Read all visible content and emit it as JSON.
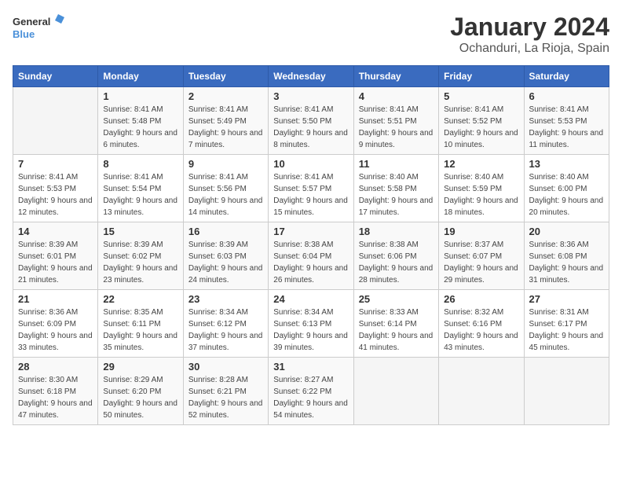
{
  "header": {
    "logo_line1": "General",
    "logo_line2": "Blue",
    "month": "January 2024",
    "location": "Ochanduri, La Rioja, Spain"
  },
  "weekdays": [
    "Sunday",
    "Monday",
    "Tuesday",
    "Wednesday",
    "Thursday",
    "Friday",
    "Saturday"
  ],
  "weeks": [
    [
      {
        "num": "",
        "sunrise": "",
        "sunset": "",
        "daylight": ""
      },
      {
        "num": "1",
        "sunrise": "Sunrise: 8:41 AM",
        "sunset": "Sunset: 5:48 PM",
        "daylight": "Daylight: 9 hours and 6 minutes."
      },
      {
        "num": "2",
        "sunrise": "Sunrise: 8:41 AM",
        "sunset": "Sunset: 5:49 PM",
        "daylight": "Daylight: 9 hours and 7 minutes."
      },
      {
        "num": "3",
        "sunrise": "Sunrise: 8:41 AM",
        "sunset": "Sunset: 5:50 PM",
        "daylight": "Daylight: 9 hours and 8 minutes."
      },
      {
        "num": "4",
        "sunrise": "Sunrise: 8:41 AM",
        "sunset": "Sunset: 5:51 PM",
        "daylight": "Daylight: 9 hours and 9 minutes."
      },
      {
        "num": "5",
        "sunrise": "Sunrise: 8:41 AM",
        "sunset": "Sunset: 5:52 PM",
        "daylight": "Daylight: 9 hours and 10 minutes."
      },
      {
        "num": "6",
        "sunrise": "Sunrise: 8:41 AM",
        "sunset": "Sunset: 5:53 PM",
        "daylight": "Daylight: 9 hours and 11 minutes."
      }
    ],
    [
      {
        "num": "7",
        "sunrise": "Sunrise: 8:41 AM",
        "sunset": "Sunset: 5:53 PM",
        "daylight": "Daylight: 9 hours and 12 minutes."
      },
      {
        "num": "8",
        "sunrise": "Sunrise: 8:41 AM",
        "sunset": "Sunset: 5:54 PM",
        "daylight": "Daylight: 9 hours and 13 minutes."
      },
      {
        "num": "9",
        "sunrise": "Sunrise: 8:41 AM",
        "sunset": "Sunset: 5:56 PM",
        "daylight": "Daylight: 9 hours and 14 minutes."
      },
      {
        "num": "10",
        "sunrise": "Sunrise: 8:41 AM",
        "sunset": "Sunset: 5:57 PM",
        "daylight": "Daylight: 9 hours and 15 minutes."
      },
      {
        "num": "11",
        "sunrise": "Sunrise: 8:40 AM",
        "sunset": "Sunset: 5:58 PM",
        "daylight": "Daylight: 9 hours and 17 minutes."
      },
      {
        "num": "12",
        "sunrise": "Sunrise: 8:40 AM",
        "sunset": "Sunset: 5:59 PM",
        "daylight": "Daylight: 9 hours and 18 minutes."
      },
      {
        "num": "13",
        "sunrise": "Sunrise: 8:40 AM",
        "sunset": "Sunset: 6:00 PM",
        "daylight": "Daylight: 9 hours and 20 minutes."
      }
    ],
    [
      {
        "num": "14",
        "sunrise": "Sunrise: 8:39 AM",
        "sunset": "Sunset: 6:01 PM",
        "daylight": "Daylight: 9 hours and 21 minutes."
      },
      {
        "num": "15",
        "sunrise": "Sunrise: 8:39 AM",
        "sunset": "Sunset: 6:02 PM",
        "daylight": "Daylight: 9 hours and 23 minutes."
      },
      {
        "num": "16",
        "sunrise": "Sunrise: 8:39 AM",
        "sunset": "Sunset: 6:03 PM",
        "daylight": "Daylight: 9 hours and 24 minutes."
      },
      {
        "num": "17",
        "sunrise": "Sunrise: 8:38 AM",
        "sunset": "Sunset: 6:04 PM",
        "daylight": "Daylight: 9 hours and 26 minutes."
      },
      {
        "num": "18",
        "sunrise": "Sunrise: 8:38 AM",
        "sunset": "Sunset: 6:06 PM",
        "daylight": "Daylight: 9 hours and 28 minutes."
      },
      {
        "num": "19",
        "sunrise": "Sunrise: 8:37 AM",
        "sunset": "Sunset: 6:07 PM",
        "daylight": "Daylight: 9 hours and 29 minutes."
      },
      {
        "num": "20",
        "sunrise": "Sunrise: 8:36 AM",
        "sunset": "Sunset: 6:08 PM",
        "daylight": "Daylight: 9 hours and 31 minutes."
      }
    ],
    [
      {
        "num": "21",
        "sunrise": "Sunrise: 8:36 AM",
        "sunset": "Sunset: 6:09 PM",
        "daylight": "Daylight: 9 hours and 33 minutes."
      },
      {
        "num": "22",
        "sunrise": "Sunrise: 8:35 AM",
        "sunset": "Sunset: 6:11 PM",
        "daylight": "Daylight: 9 hours and 35 minutes."
      },
      {
        "num": "23",
        "sunrise": "Sunrise: 8:34 AM",
        "sunset": "Sunset: 6:12 PM",
        "daylight": "Daylight: 9 hours and 37 minutes."
      },
      {
        "num": "24",
        "sunrise": "Sunrise: 8:34 AM",
        "sunset": "Sunset: 6:13 PM",
        "daylight": "Daylight: 9 hours and 39 minutes."
      },
      {
        "num": "25",
        "sunrise": "Sunrise: 8:33 AM",
        "sunset": "Sunset: 6:14 PM",
        "daylight": "Daylight: 9 hours and 41 minutes."
      },
      {
        "num": "26",
        "sunrise": "Sunrise: 8:32 AM",
        "sunset": "Sunset: 6:16 PM",
        "daylight": "Daylight: 9 hours and 43 minutes."
      },
      {
        "num": "27",
        "sunrise": "Sunrise: 8:31 AM",
        "sunset": "Sunset: 6:17 PM",
        "daylight": "Daylight: 9 hours and 45 minutes."
      }
    ],
    [
      {
        "num": "28",
        "sunrise": "Sunrise: 8:30 AM",
        "sunset": "Sunset: 6:18 PM",
        "daylight": "Daylight: 9 hours and 47 minutes."
      },
      {
        "num": "29",
        "sunrise": "Sunrise: 8:29 AM",
        "sunset": "Sunset: 6:20 PM",
        "daylight": "Daylight: 9 hours and 50 minutes."
      },
      {
        "num": "30",
        "sunrise": "Sunrise: 8:28 AM",
        "sunset": "Sunset: 6:21 PM",
        "daylight": "Daylight: 9 hours and 52 minutes."
      },
      {
        "num": "31",
        "sunrise": "Sunrise: 8:27 AM",
        "sunset": "Sunset: 6:22 PM",
        "daylight": "Daylight: 9 hours and 54 minutes."
      },
      {
        "num": "",
        "sunrise": "",
        "sunset": "",
        "daylight": ""
      },
      {
        "num": "",
        "sunrise": "",
        "sunset": "",
        "daylight": ""
      },
      {
        "num": "",
        "sunrise": "",
        "sunset": "",
        "daylight": ""
      }
    ]
  ]
}
